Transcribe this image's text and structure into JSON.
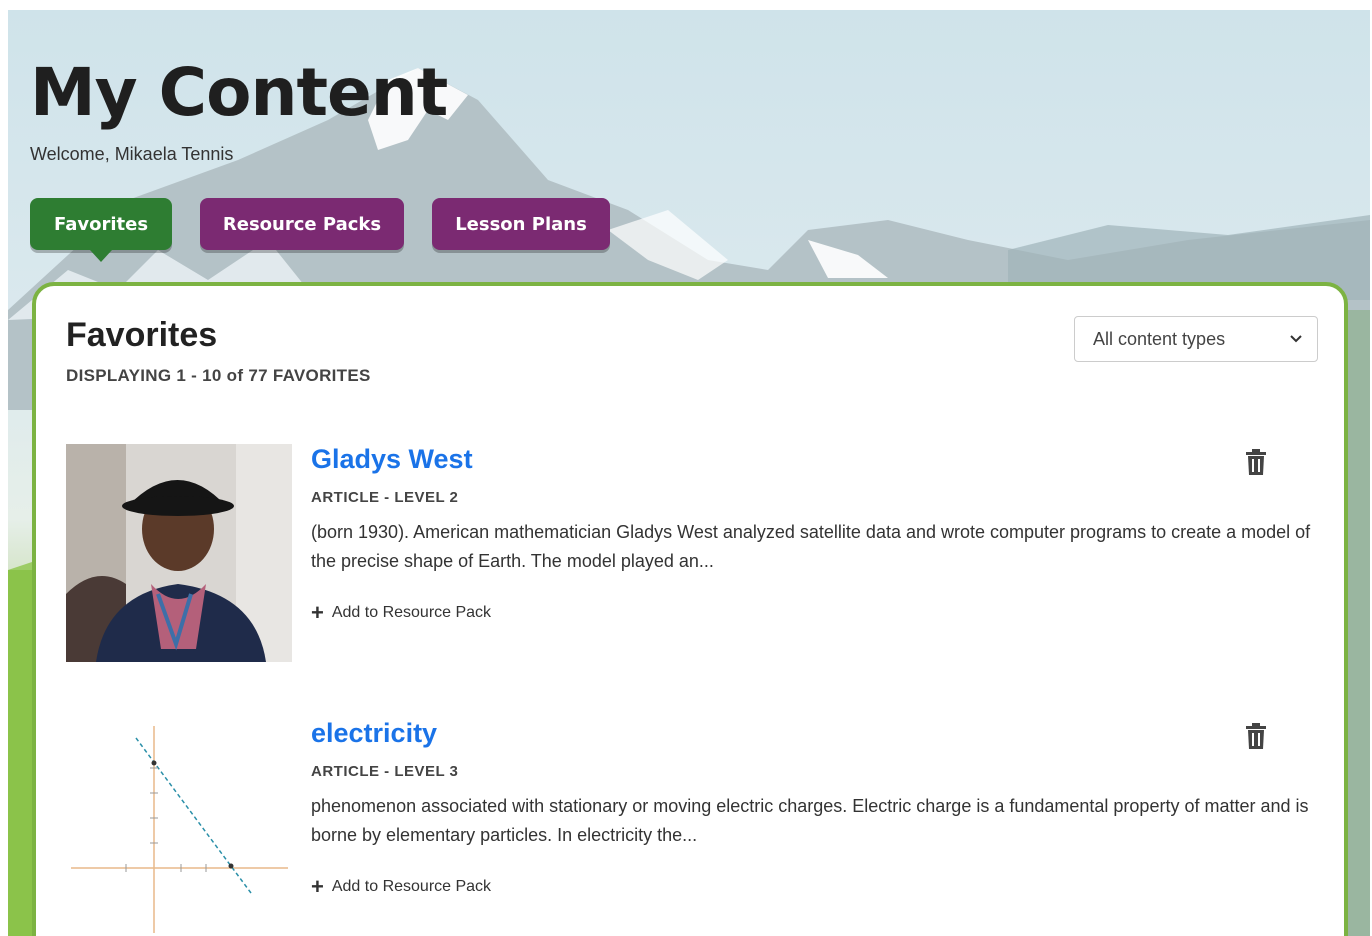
{
  "header": {
    "title": "My Content",
    "welcome": "Welcome, Mikaela Tennis"
  },
  "tabs": [
    {
      "label": "Favorites",
      "active": true
    },
    {
      "label": "Resource Packs",
      "active": false
    },
    {
      "label": "Lesson Plans",
      "active": false
    }
  ],
  "favorites": {
    "heading": "Favorites",
    "displaying": "DISPLAYING 1 - 10 of 77 FAVORITES",
    "filter": {
      "selected": "All content types"
    },
    "items": [
      {
        "title": "Gladys West",
        "meta": "ARTICLE - LEVEL 2",
        "description": "(born 1930). American mathematician Gladys West analyzed satellite data and wrote computer programs to create a model of the precise shape of Earth. The model played an...",
        "add_label": "Add to Resource Pack"
      },
      {
        "title": "electricity",
        "meta": "ARTICLE - LEVEL 3",
        "description": "phenomenon associated with stationary or moving electric charges. Electric charge is a fundamental property of matter and is borne by elementary particles. In electricity the...",
        "add_label": "Add to Resource Pack"
      }
    ]
  },
  "colors": {
    "active_tab": "#2e7d32",
    "inactive_tab": "#7b2a72",
    "panel_border": "#7cb342",
    "link": "#1a73e8"
  },
  "icons": [
    "trash-icon",
    "plus-icon",
    "chevron-down-icon"
  ]
}
